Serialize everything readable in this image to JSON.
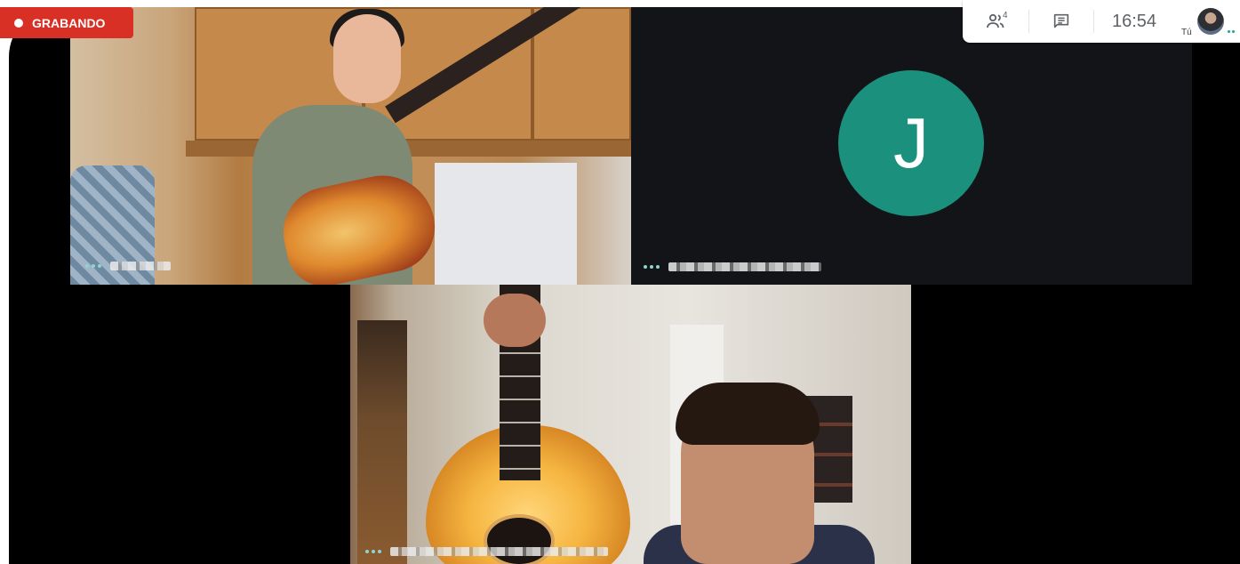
{
  "recording": {
    "label": "GRABANDO"
  },
  "toolbar": {
    "people_count": "4",
    "clock": "16:54",
    "self_label": "Tú"
  },
  "tiles": [
    {
      "kind": "video"
    },
    {
      "kind": "avatar",
      "initial": "J",
      "avatar_color": "#1b907c"
    },
    {
      "kind": "video"
    }
  ],
  "icons": [
    "record-dot-icon",
    "people-icon",
    "chat-icon",
    "more-options-icon"
  ],
  "colors": {
    "recording": "#d93025",
    "avatar": "#1b907c",
    "stage": "#000000"
  }
}
